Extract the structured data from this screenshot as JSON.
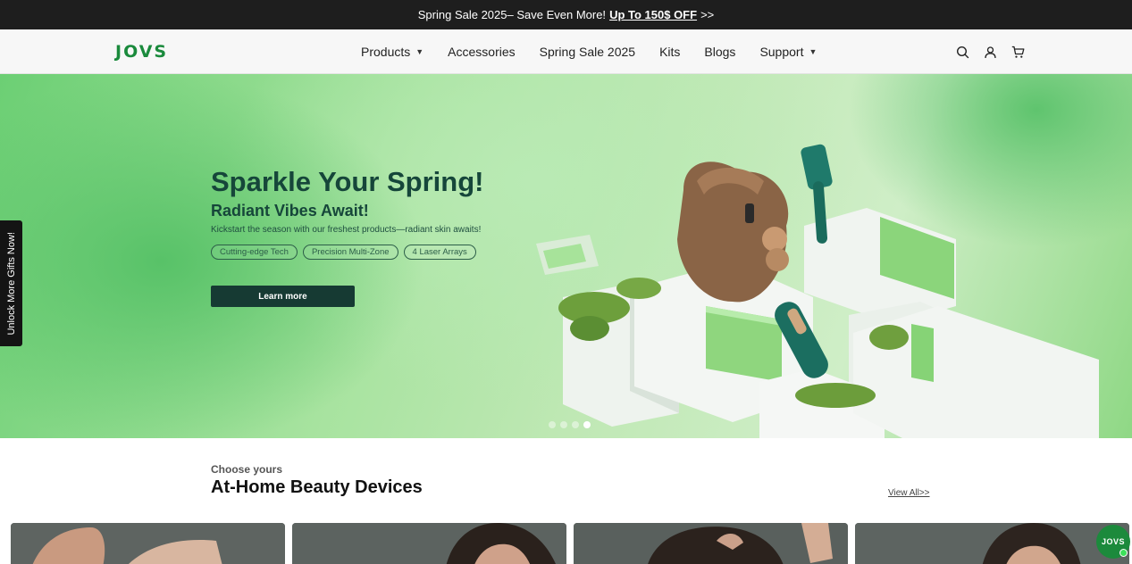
{
  "announcement": {
    "text": "Spring Sale 2025– Save Even More!",
    "cta": "Up To 150$ OFF",
    "arrows": ">>"
  },
  "header": {
    "logo": "JOVS",
    "nav": [
      {
        "label": "Products",
        "has_dropdown": true
      },
      {
        "label": "Accessories",
        "has_dropdown": false
      },
      {
        "label": "Spring Sale 2025",
        "has_dropdown": false
      },
      {
        "label": "Kits",
        "has_dropdown": false
      },
      {
        "label": "Blogs",
        "has_dropdown": false
      },
      {
        "label": "Support",
        "has_dropdown": true
      }
    ],
    "icons": [
      "search-icon",
      "account-icon",
      "cart-icon"
    ]
  },
  "hero": {
    "title": "Sparkle Your Spring!",
    "subtitle": "Radiant Vibes Await!",
    "description": "Kickstart the season with our freshest products—radiant skin awaits!",
    "tags": [
      "Cutting-edge Tech",
      "Precision Multi-Zone",
      "4 Laser Arrays"
    ],
    "button": "Learn more",
    "slide_count": 4,
    "active_slide": 4
  },
  "side_tab": {
    "label": "Unlock More Gifts Now!"
  },
  "section": {
    "eyebrow": "Choose yours",
    "title": "At-Home Beauty Devices",
    "view_all": "View All>>"
  },
  "chat": {
    "label": "JOVS"
  },
  "colors": {
    "brand_green": "#1a8a3c",
    "dark_green": "#16463a",
    "button_bg": "#163a33",
    "announce_bg": "#1e1e1e"
  }
}
